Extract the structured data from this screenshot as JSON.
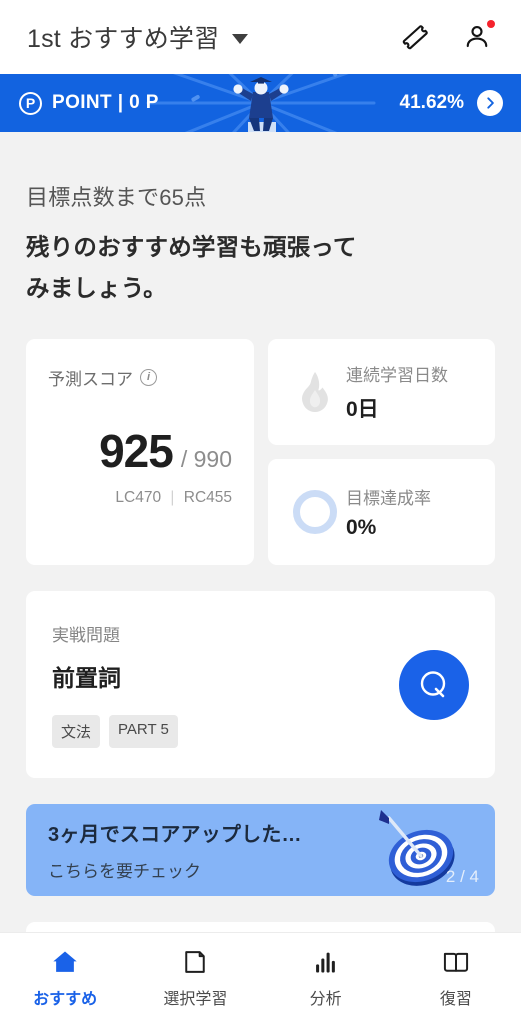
{
  "appbar": {
    "title": "1st おすすめ学習",
    "dropdown_icon": "chevron-down-icon",
    "ticket_icon": "ticket-icon",
    "profile_icon": "person-icon",
    "has_notification": true
  },
  "point_banner": {
    "badge": "P",
    "label": "POINT | 0 P",
    "percent": "41.62%",
    "arrow_icon": "chevron-right-icon",
    "background_color": "#1263e0"
  },
  "headline": {
    "goal_text": "目標点数まで65点",
    "message_line1": "残りのおすすめ学習も頑張って",
    "message_line2": "みましょう。"
  },
  "score_card": {
    "label": "予測スコア",
    "info_icon": "info-icon",
    "score": "925",
    "total": "/ 990",
    "lc": "LC470",
    "divider": "|",
    "rc": "RC455"
  },
  "streak_card": {
    "icon": "flame-icon",
    "label": "連続学習日数",
    "value": "0日"
  },
  "goal_card": {
    "icon": "progress-ring-icon",
    "label": "目標達成率",
    "value": "0%",
    "ring_color": "#cbdcf6"
  },
  "practice_card": {
    "kicker": "実戦問題",
    "title": "前置詞",
    "tags": [
      "文法",
      "PART 5"
    ],
    "action_icon": "q-icon",
    "action_color": "#1a62e8"
  },
  "promo_banner": {
    "title": "3ヶ月でスコアアップした…",
    "subtitle": "こちらを要チェック",
    "art_icon": "dartboard-icon",
    "pager": "2 / 4",
    "background_color": "#85b4f7"
  },
  "bottom_nav": {
    "items": [
      {
        "label": "おすすめ",
        "icon": "home-icon",
        "active": true
      },
      {
        "label": "選択学習",
        "icon": "page-icon",
        "active": false
      },
      {
        "label": "分析",
        "icon": "bar-chart-icon",
        "active": false
      },
      {
        "label": "復習",
        "icon": "book-icon",
        "active": false
      }
    ],
    "active_color": "#1a62e8"
  }
}
